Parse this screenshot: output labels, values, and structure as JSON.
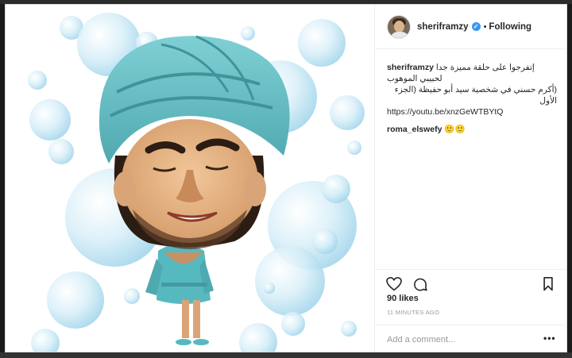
{
  "post": {
    "username": "sheriframzy",
    "follow_status": "Following",
    "separator": "•",
    "verified_glyph": "✓",
    "caption": {
      "username": "sheriframzy",
      "line1": "إتفرجوا على حلقة مميزة جدا لحبيبي الموهوب",
      "line2": "(أكرم حسني في شخصية سيد أبو حفيظة (الجزء الأول",
      "link": "https://youtu.be/xnzGeWTBYtQ"
    },
    "comment": {
      "username": "roma_elswefy",
      "text": "🙂🙂"
    },
    "likes": "90 likes",
    "timestamp": "11 MINUTES AGO",
    "add_comment_placeholder": "Add a comment...",
    "more_label": "•••"
  },
  "icons": {
    "like": "heart-icon",
    "comment": "comment-icon",
    "save": "bookmark-icon",
    "verified": "verified-badge-icon"
  },
  "colors": {
    "verified": "#3897f0",
    "text": "#262626",
    "muted": "#999999",
    "turban": "#6cc4c9",
    "robe": "#57b9c0"
  }
}
